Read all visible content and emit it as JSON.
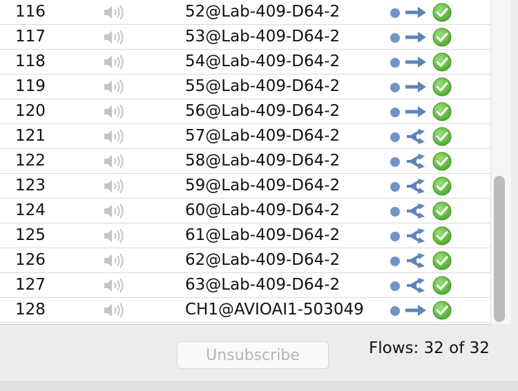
{
  "rows": [
    {
      "number": "116",
      "name": "52@Lab-409-D64-2",
      "flow": "unicast-arrow",
      "status": "ok"
    },
    {
      "number": "117",
      "name": "53@Lab-409-D64-2",
      "flow": "unicast-arrow",
      "status": "ok"
    },
    {
      "number": "118",
      "name": "54@Lab-409-D64-2",
      "flow": "unicast-arrow",
      "status": "ok"
    },
    {
      "number": "119",
      "name": "55@Lab-409-D64-2",
      "flow": "unicast-arrow",
      "status": "ok"
    },
    {
      "number": "120",
      "name": "56@Lab-409-D64-2",
      "flow": "unicast-arrow",
      "status": "ok"
    },
    {
      "number": "121",
      "name": "57@Lab-409-D64-2",
      "flow": "multicast-arrow",
      "status": "ok"
    },
    {
      "number": "122",
      "name": "58@Lab-409-D64-2",
      "flow": "multicast-arrow",
      "status": "ok"
    },
    {
      "number": "123",
      "name": "59@Lab-409-D64-2",
      "flow": "multicast-arrow",
      "status": "ok"
    },
    {
      "number": "124",
      "name": "60@Lab-409-D64-2",
      "flow": "multicast-arrow",
      "status": "ok"
    },
    {
      "number": "125",
      "name": "61@Lab-409-D64-2",
      "flow": "multicast-arrow",
      "status": "ok"
    },
    {
      "number": "126",
      "name": "62@Lab-409-D64-2",
      "flow": "multicast-arrow",
      "status": "ok"
    },
    {
      "number": "127",
      "name": "63@Lab-409-D64-2",
      "flow": "multicast-arrow",
      "status": "ok"
    },
    {
      "number": "128",
      "name": "CH1@AVIOAI1-503049",
      "flow": "unicast-arrow",
      "status": "ok"
    }
  ],
  "footer": {
    "unsubscribe_label": "Unsubscribe",
    "flows_text": "Flows: 32 of 32"
  },
  "colors": {
    "flow_blue": "#5b84bf",
    "check_green": "#4caf2a",
    "speaker_gray": "#c4c4c4"
  }
}
